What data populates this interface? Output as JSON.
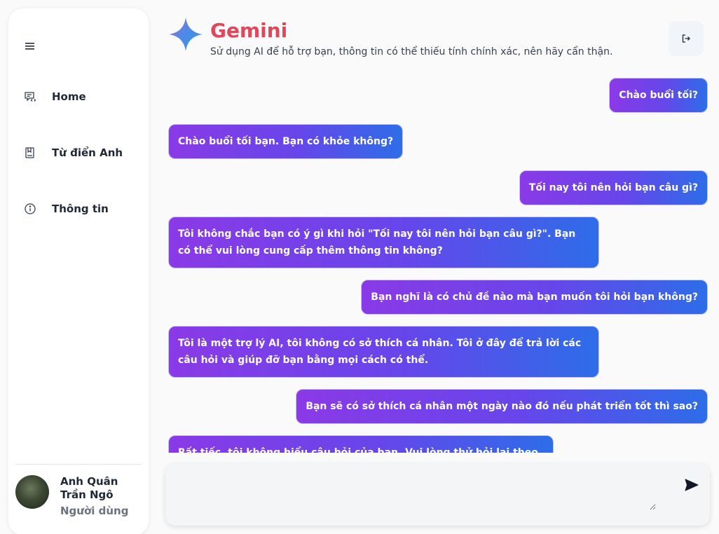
{
  "sidebar": {
    "menu_icon": "hamburger-icon",
    "items": [
      {
        "label": "Home",
        "icon": "chat-icon"
      },
      {
        "label": "Từ điển Anh",
        "icon": "book-icon"
      },
      {
        "label": "Thông tin",
        "icon": "info-icon"
      }
    ],
    "user": {
      "name": "Anh Quân Trần Ngô",
      "role": "Người dùng"
    }
  },
  "header": {
    "title": "Gemini",
    "subtitle": "Sử dụng AI để hỗ trợ bạn, thông tin có thể thiếu tính chính xác, nên hãy cẩn thận.",
    "logo_icon": "gemini-sparkle-icon",
    "logout_icon": "logout-icon"
  },
  "messages": [
    {
      "role": "user",
      "text": "Chào buổi tối?"
    },
    {
      "role": "bot",
      "text": "Chào buổi tối bạn. Bạn có khỏe không?"
    },
    {
      "role": "user",
      "text": "Tối nay tôi nên hỏi bạn câu gì?"
    },
    {
      "role": "bot",
      "text": "Tôi không chắc bạn có ý gì khi hỏi \"Tối nay tôi nên hỏi bạn câu gì?\". Bạn có thể vui lòng cung cấp thêm thông tin không?"
    },
    {
      "role": "user",
      "text": "Bạn nghĩ là có chủ đề nào mà bạn muốn tôi hỏi bạn không?"
    },
    {
      "role": "bot",
      "text": "Tôi là một trợ lý AI, tôi không có sở thích cá nhân. Tôi ở đây để trả lời các câu hỏi và giúp đỡ bạn bằng mọi cách có thể."
    },
    {
      "role": "user",
      "text": "Bạn sẽ có sở thích cá nhân một ngày nào đó nếu phát triển tốt thì sao?"
    },
    {
      "role": "bot",
      "text": "Rất tiếc, tôi không hiểu câu hỏi của bạn. Vui lòng thử hỏi lại theo cách khác."
    }
  ],
  "composer": {
    "value": "",
    "send_icon": "send-icon"
  },
  "colors": {
    "accent_title": "#e0475a",
    "bubble_start": "#8a3ae6",
    "bubble_end": "#2d6de8"
  }
}
